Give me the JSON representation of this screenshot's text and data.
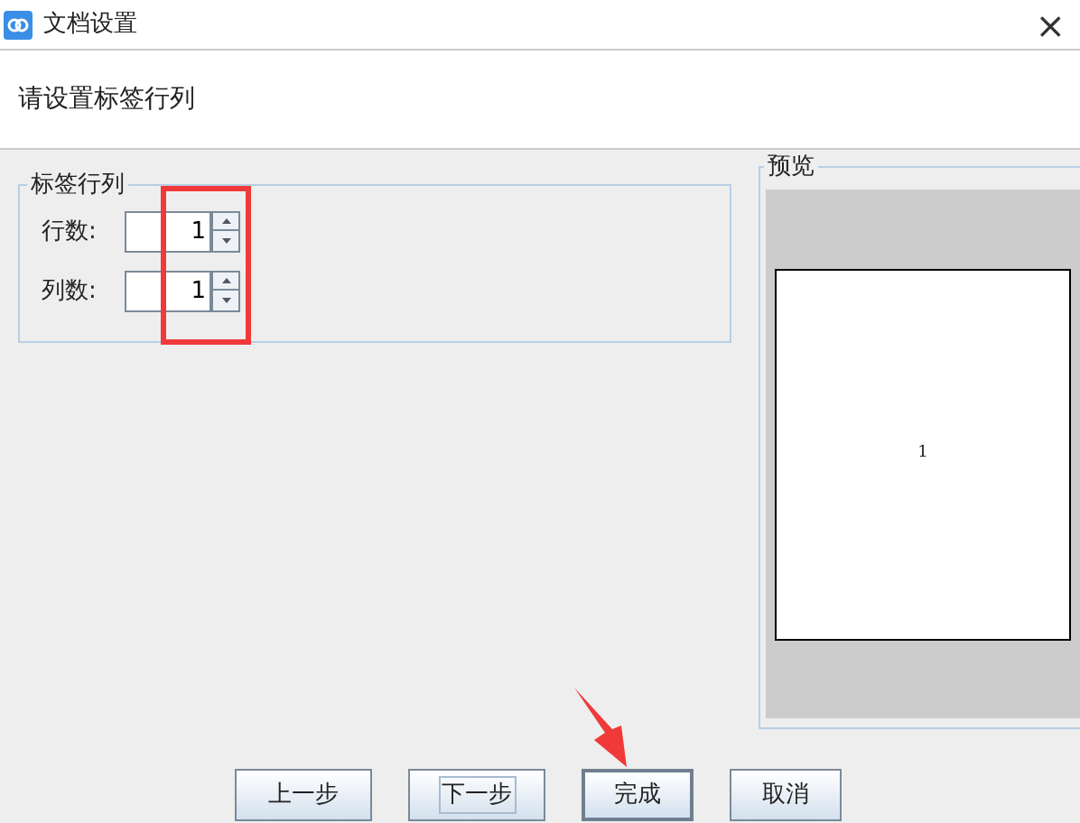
{
  "window": {
    "title": "文档设置",
    "close": "×"
  },
  "header": {
    "text": "请设置标签行列"
  },
  "group": {
    "title": "标签行列",
    "fields": [
      {
        "label": "行数:",
        "value": "1"
      },
      {
        "label": "列数:",
        "value": "1"
      }
    ]
  },
  "preview": {
    "title": "预览",
    "cell": "1"
  },
  "buttons": [
    {
      "label": "上一步",
      "focused": false,
      "default": false
    },
    {
      "label": "下一步",
      "focused": true,
      "default": false
    },
    {
      "label": "完成",
      "focused": false,
      "default": true
    },
    {
      "label": "取消",
      "focused": false,
      "default": false
    }
  ]
}
